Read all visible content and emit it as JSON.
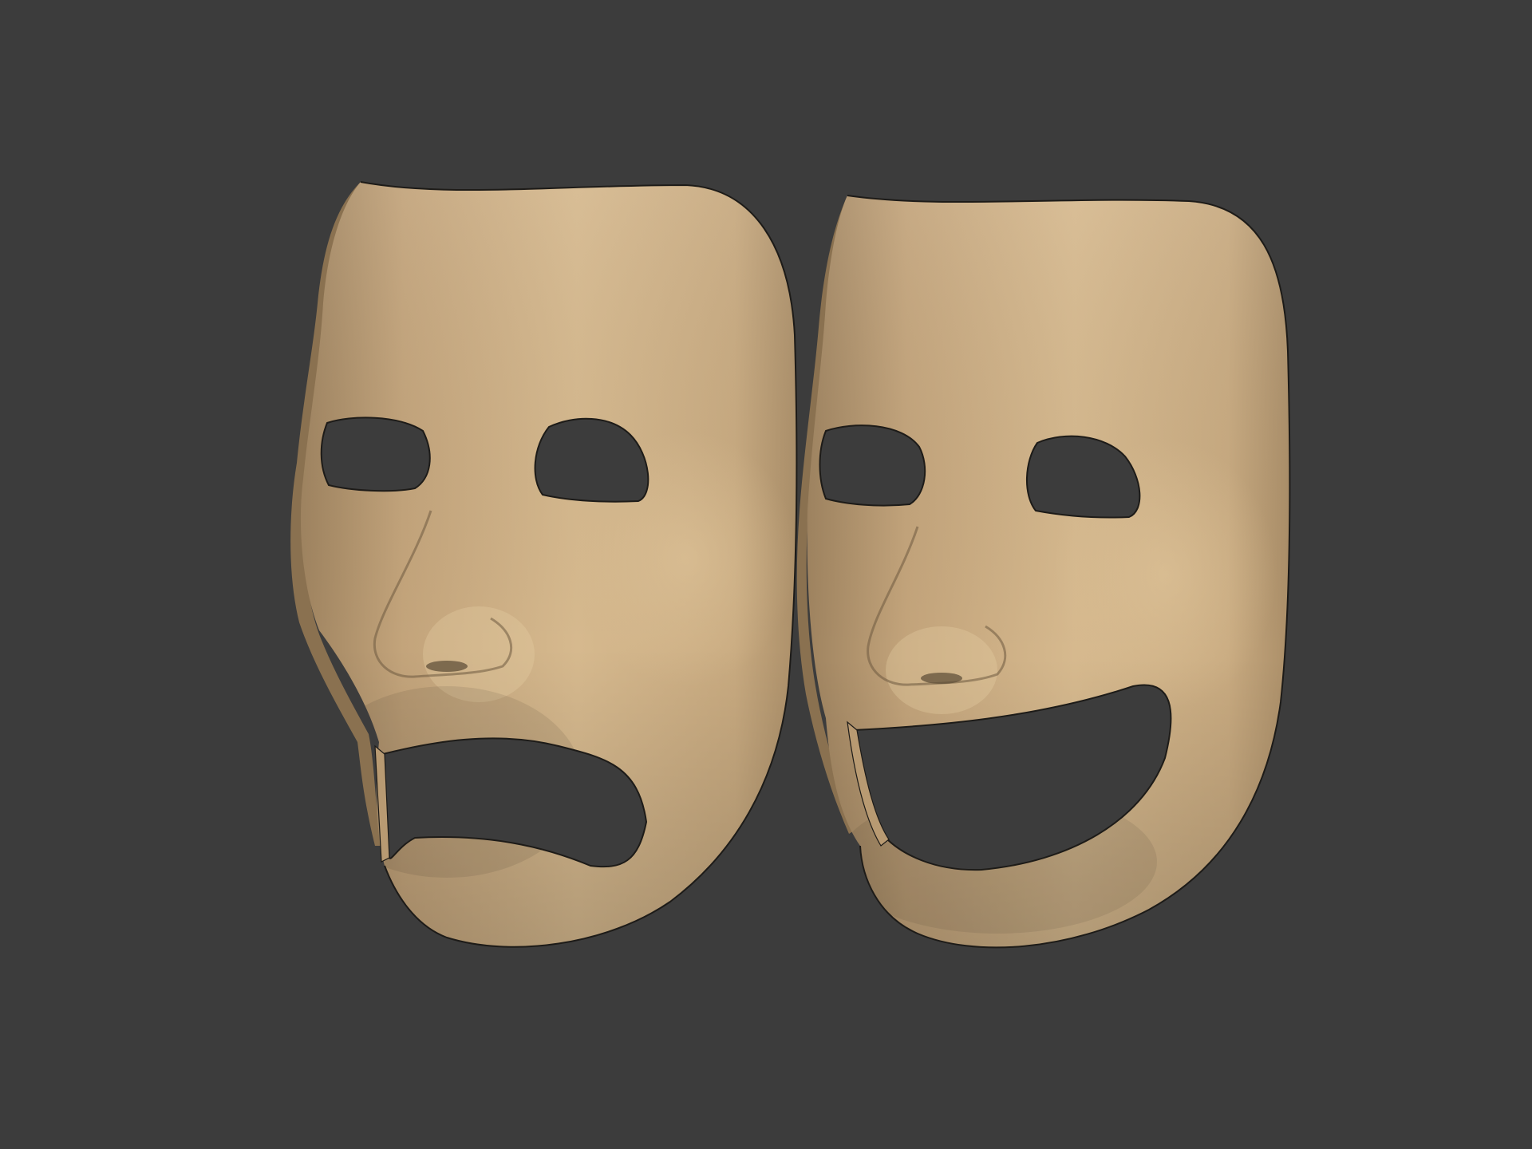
{
  "viewport": {
    "background_color": "#3c3c3c",
    "render_mode": "wireframe-on-shaded"
  },
  "models": [
    {
      "name": "tragedy-mask",
      "expression": "sad",
      "base_color": "#c9a97e",
      "wire_color": "#1d1b18"
    },
    {
      "name": "comedy-mask",
      "expression": "happy",
      "base_color": "#c9a97e",
      "wire_color": "#1d1b18"
    }
  ]
}
